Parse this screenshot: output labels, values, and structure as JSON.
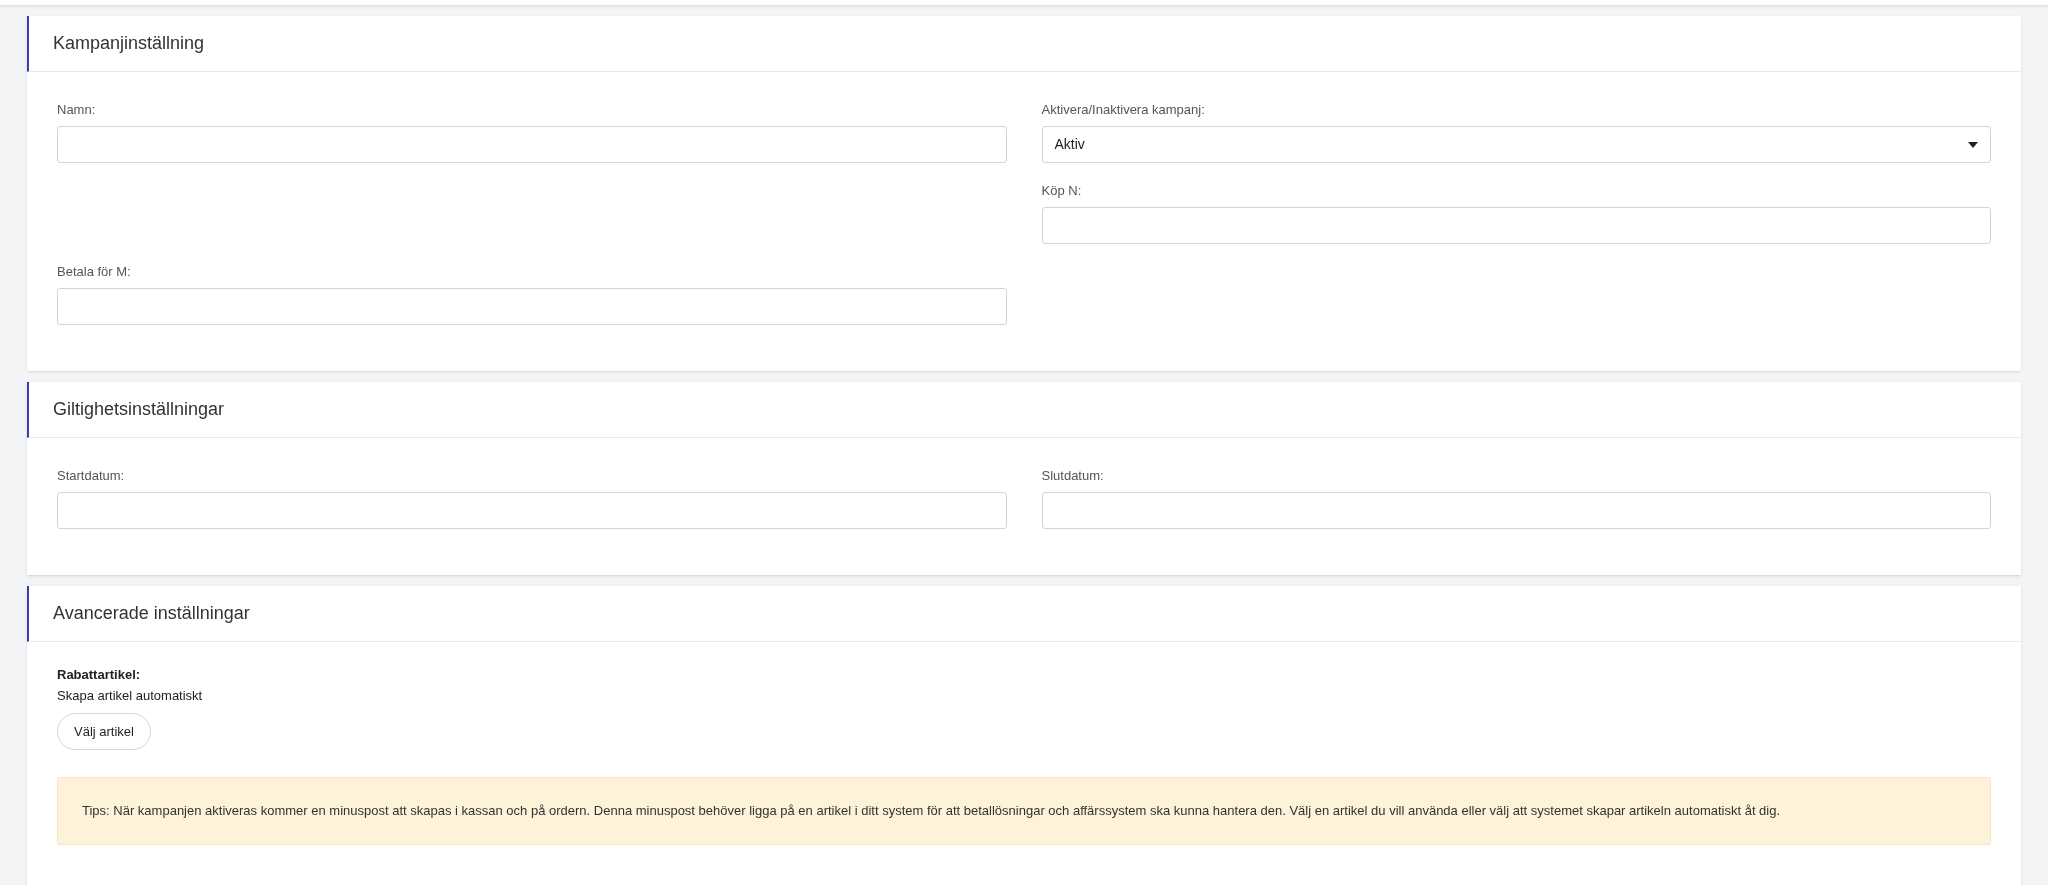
{
  "sections": [
    {
      "title": "Kampanjinställning",
      "rows": [
        {
          "left": {
            "kind": "text",
            "label": "Namn:"
          },
          "right": {
            "kind": "select",
            "label": "Aktivera/Inaktivera kampanj:",
            "value": "Aktiv"
          }
        },
        {
          "right": {
            "kind": "text",
            "label": "Köp N:"
          }
        },
        {
          "left": {
            "kind": "text",
            "label": "Betala för M:"
          }
        }
      ]
    },
    {
      "title": "Giltighetsinställningar",
      "rows": [
        {
          "left": {
            "kind": "text",
            "label": "Startdatum:"
          },
          "right": {
            "kind": "text",
            "label": "Slutdatum:"
          }
        }
      ]
    },
    {
      "title": "Avancerade inställningar",
      "discount_article": {
        "label": "Rabattartikel:",
        "value": "Skapa artikel automatiskt",
        "button": "Välj artikel"
      },
      "tip": "Tips: När kampanjen aktiveras kommer en minuspost att skapas i kassan och på ordern. Denna minuspost behöver ligga på en artikel i ditt system för att betallösningar och affärssystem ska kunna hantera den. Välj en artikel du vill använda eller välj att systemet skapar artikeln automatiskt åt dig."
    }
  ]
}
